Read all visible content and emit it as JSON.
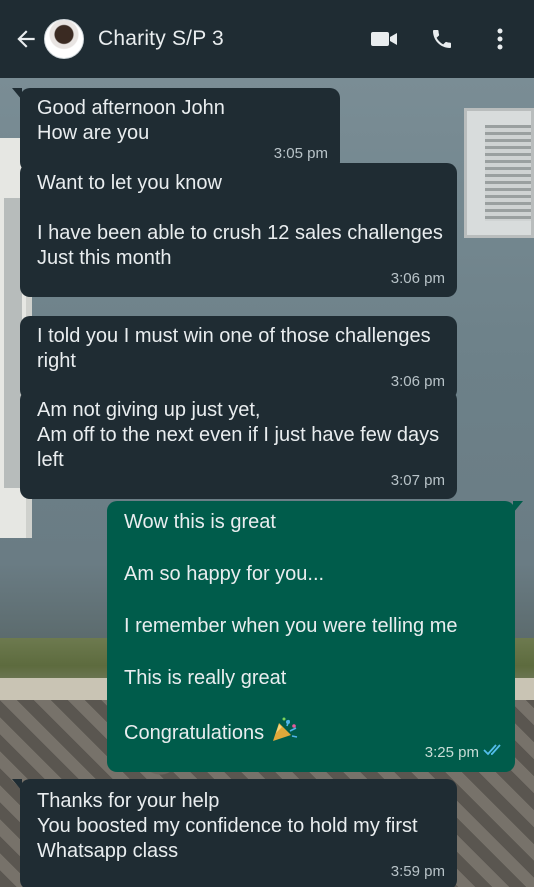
{
  "header": {
    "contact_name": "Charity S/P 3",
    "icons": [
      "back-arrow-icon",
      "video-call-icon",
      "voice-call-icon",
      "more-options-icon"
    ]
  },
  "messages": [
    {
      "direction": "in",
      "text": "Good afternoon John\nHow are you",
      "time": "3:05 pm"
    },
    {
      "direction": "in",
      "text": "Want to let you know\n\nI have been able to crush 12 sales challenges\nJust this month",
      "time": "3:06 pm"
    },
    {
      "direction": "in",
      "text": "I told you I must win one of those challenges right",
      "time": "3:06 pm"
    },
    {
      "direction": "in",
      "text": "Am not giving up just yet,\nAm off to the next even if I just have few days left",
      "time": "3:07 pm"
    },
    {
      "direction": "out",
      "text": "Wow this is great\n\nAm so happy for you...\n\nI remember when you were telling me\n\nThis is really great\n\nCongratulations",
      "time": "3:25 pm",
      "status": "read",
      "emoji": "confetti-icon"
    },
    {
      "direction": "in",
      "text": "Thanks for your help\nYou boosted my confidence to hold my first Whatsapp class",
      "time": "3:59 pm"
    }
  ],
  "colors": {
    "header_bg": "#1f2c33",
    "incoming_bubble": "#1f2c33",
    "outgoing_bubble": "#005c4b",
    "read_ticks": "#53bdeb"
  }
}
